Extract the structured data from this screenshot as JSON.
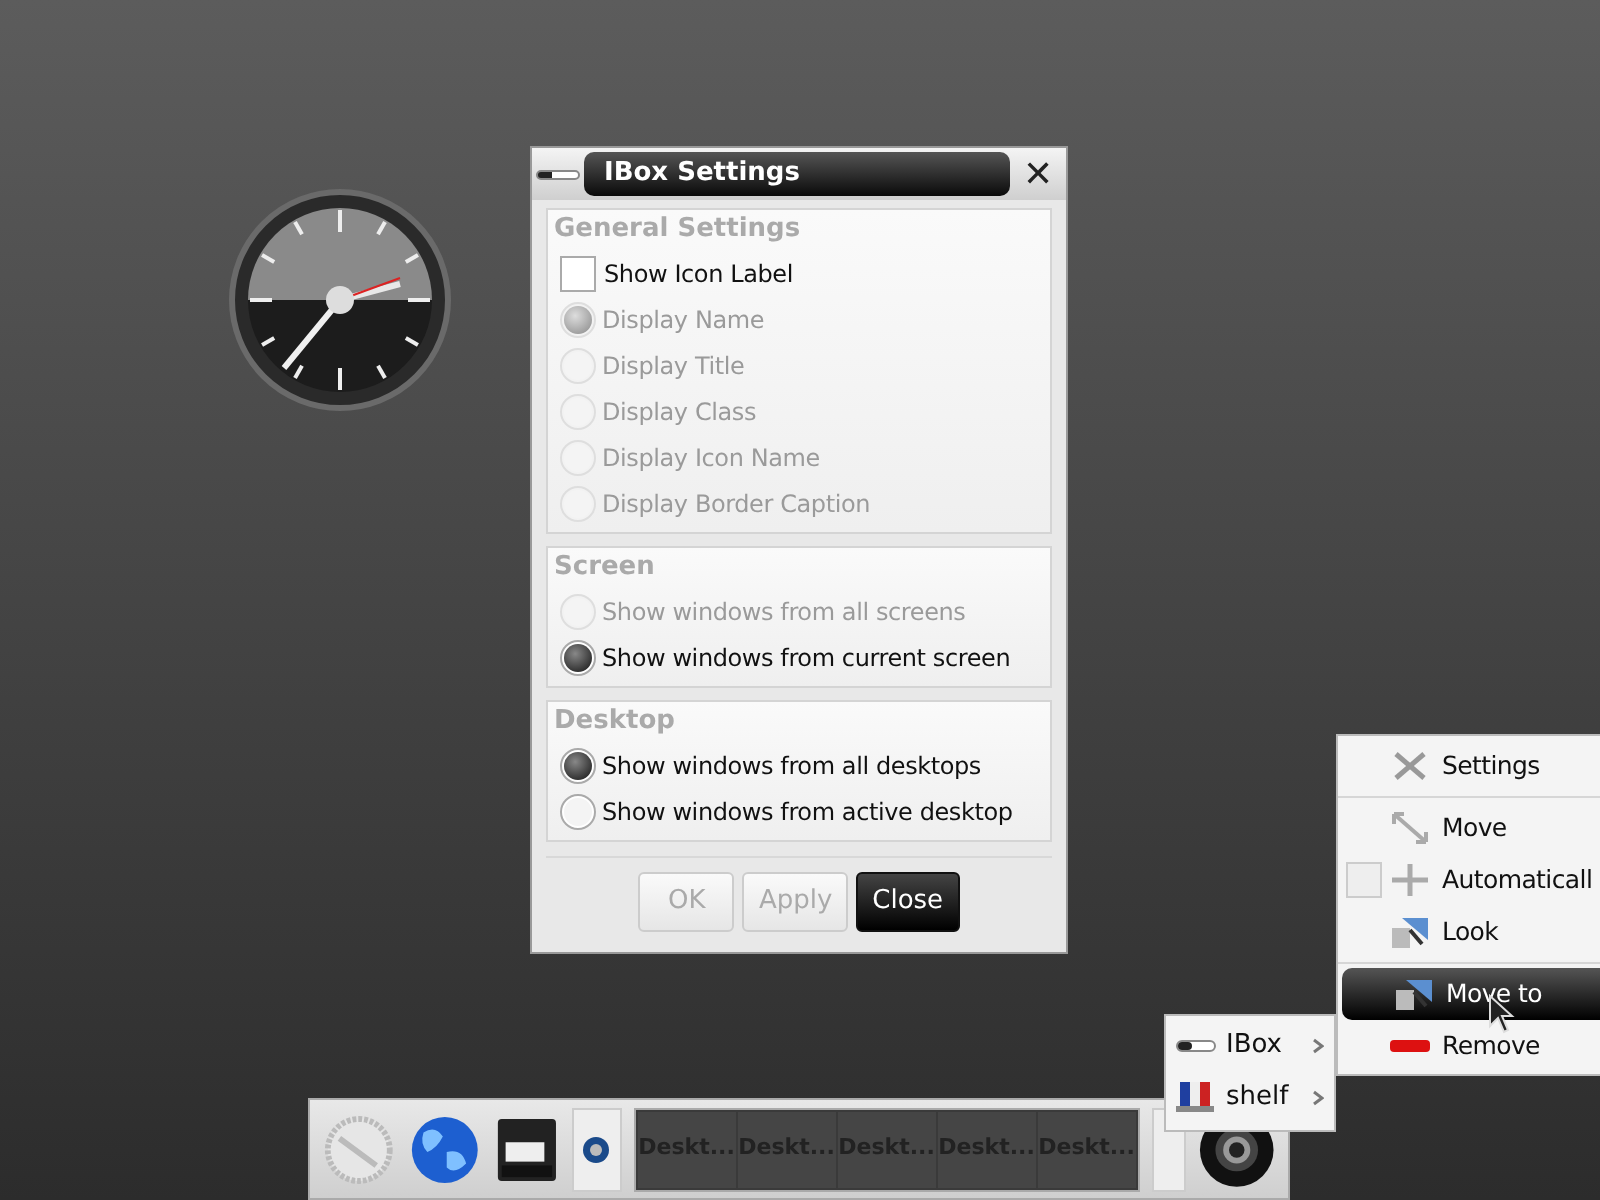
{
  "dialog": {
    "title": "IBox Settings",
    "close": "✕",
    "sections": [
      {
        "title": "General Settings",
        "options": [
          {
            "kind": "check",
            "label": "Show Icon Label",
            "checked": false,
            "disabled": false
          },
          {
            "kind": "radio",
            "label": "Display Name",
            "selected": true,
            "disabled": true
          },
          {
            "kind": "radio",
            "label": "Display Title",
            "selected": false,
            "disabled": true
          },
          {
            "kind": "radio",
            "label": "Display Class",
            "selected": false,
            "disabled": true
          },
          {
            "kind": "radio",
            "label": "Display Icon Name",
            "selected": false,
            "disabled": true
          },
          {
            "kind": "radio",
            "label": "Display Border Caption",
            "selected": false,
            "disabled": true
          }
        ]
      },
      {
        "title": "Screen",
        "options": [
          {
            "kind": "radio",
            "label": "Show windows from all screens",
            "selected": false,
            "disabled": true
          },
          {
            "kind": "radio",
            "label": "Show windows from current screen",
            "selected": true,
            "disabled": false
          }
        ]
      },
      {
        "title": "Desktop",
        "options": [
          {
            "kind": "radio",
            "label": "Show windows from all desktops",
            "selected": true,
            "disabled": false
          },
          {
            "kind": "radio",
            "label": "Show windows from active desktop",
            "selected": false,
            "disabled": false
          }
        ]
      }
    ],
    "buttons": [
      {
        "label": "OK",
        "disabled": true,
        "selected": false
      },
      {
        "label": "Apply",
        "disabled": true,
        "selected": false
      },
      {
        "label": "Close",
        "disabled": false,
        "selected": true
      }
    ]
  },
  "context_menu": {
    "groups": [
      [
        {
          "label": "Settings",
          "selected": false
        }
      ],
      [
        {
          "label": "Move",
          "selected": false
        },
        {
          "label": "Automaticall",
          "selected": false,
          "checked": false
        },
        {
          "label": "Look",
          "selected": false
        }
      ],
      [
        {
          "label": "Move to",
          "selected": true
        },
        {
          "label": "Remove",
          "selected": false
        }
      ]
    ]
  },
  "submenu": {
    "items": [
      {
        "label": "IBox"
      },
      {
        "label": "shelf"
      }
    ]
  },
  "shelf": {
    "desktops": [
      {
        "label": "Deskt..."
      },
      {
        "label": "Deskt..."
      },
      {
        "label": "Deskt..."
      },
      {
        "label": "Deskt..."
      },
      {
        "label": "Deskt..."
      }
    ]
  }
}
